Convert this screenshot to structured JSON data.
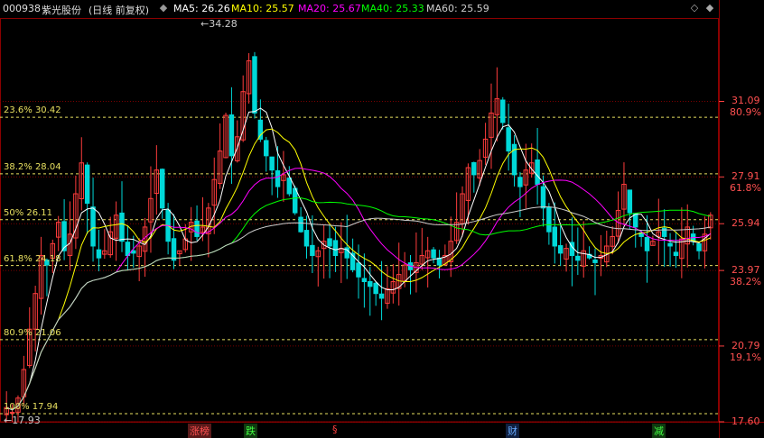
{
  "header": {
    "code": "000938",
    "name": "紫光股份",
    "mode": "(日线 前复权)",
    "ma5": {
      "label": "MA5:",
      "value": "26.26",
      "color": "#ffffff"
    },
    "ma10": {
      "label": "MA10:",
      "value": "25.57",
      "color": "#ffff00"
    },
    "ma20": {
      "label": "MA20:",
      "value": "25.67",
      "color": "#ff00ff"
    },
    "ma40": {
      "label": "MA40:",
      "value": "25.33",
      "color": "#00ff00"
    },
    "ma60": {
      "label": "MA60:",
      "value": "25.59",
      "color": "#cccccc"
    },
    "scroll_up_icon": "◇",
    "settings_icon": "◆"
  },
  "price_axis": {
    "max_marker": "34.28",
    "min_marker": "17.93",
    "ticks": [
      {
        "price": "31.09",
        "pct": "80.9%",
        "value": 31.09
      },
      {
        "price": "27.91",
        "pct": "61.8%",
        "value": 27.91
      },
      {
        "price": "25.94",
        "pct": "",
        "value": 25.94
      },
      {
        "price": "23.97",
        "pct": "38.2%",
        "value": 23.97
      },
      {
        "price": "20.79",
        "pct": "19.1%",
        "value": 20.79
      },
      {
        "price": "17.60",
        "pct": "",
        "value": 17.6
      }
    ]
  },
  "fibonacci": [
    {
      "label": "23.6% 30.42",
      "value": 30.42
    },
    {
      "label": "38.2% 28.04",
      "value": 28.04
    },
    {
      "label": "50% 26.11",
      "value": 26.11
    },
    {
      "label": "61.8% 24.18",
      "value": 24.18
    },
    {
      "label": "80.9% 21.06",
      "value": 21.06
    },
    {
      "label": "100% 17.94",
      "value": 17.94
    }
  ],
  "events": [
    {
      "label": "涨榜",
      "color": "#ff5050",
      "bg": "#5a1a1a"
    },
    {
      "label": "跌",
      "color": "#40ff40",
      "bg": "#103a10"
    },
    {
      "label": "§",
      "color": "#ff4040",
      "bg": "transparent"
    },
    {
      "label": "财",
      "color": "#66aaff",
      "bg": "#102040"
    },
    {
      "label": "减",
      "color": "#40ff40",
      "bg": "#103a10"
    }
  ],
  "chart_data": {
    "type": "candlestick",
    "ylim": [
      17.6,
      34.6
    ],
    "series": [
      {
        "name": "MA5",
        "color": "#ffffff"
      },
      {
        "name": "MA10",
        "color": "#ffff00"
      },
      {
        "name": "MA20",
        "color": "#ff00ff"
      },
      {
        "name": "MA40",
        "color": "#00ff00"
      },
      {
        "name": "MA60",
        "color": "#cccccc"
      }
    ],
    "closes": [
      18.2,
      18.0,
      18.6,
      19.8,
      21.5,
      23.0,
      24.6,
      24.2,
      25.1,
      26.0,
      24.8,
      25.5,
      27.2,
      28.5,
      26.8,
      25.0,
      24.5,
      24.8,
      25.6,
      26.3,
      25.2,
      24.6,
      24.7,
      25.0,
      25.8,
      27.0,
      28.2,
      26.6,
      25.2,
      24.4,
      24.8,
      25.3,
      26.0,
      25.4,
      25.8,
      26.6,
      27.8,
      29.0,
      30.5,
      28.8,
      29.6,
      31.5,
      32.8,
      30.6,
      29.5,
      28.8,
      28.2,
      27.5,
      28.0,
      27.2,
      26.4,
      25.6,
      25.0,
      24.6,
      24.8,
      25.2,
      25.0,
      24.6,
      24.9,
      24.5,
      24.0,
      23.7,
      23.5,
      23.3,
      23.0,
      22.8,
      23.2,
      23.5,
      23.8,
      24.2,
      24.0,
      24.3,
      24.6,
      24.8,
      24.5,
      24.2,
      24.6,
      25.2,
      26.0,
      27.2,
      28.3,
      28.0,
      28.6,
      29.5,
      30.6,
      31.2,
      30.2,
      29.0,
      28.0,
      27.5,
      28.2,
      28.5,
      27.6,
      26.6,
      25.6,
      25.0,
      24.7,
      24.9,
      24.6,
      24.4,
      24.8,
      24.5,
      24.3,
      24.6,
      25.0,
      25.4,
      26.5,
      27.6,
      26.4,
      25.8,
      25.4,
      24.8,
      25.2,
      25.6,
      25.4,
      25.0,
      24.6,
      25.3,
      25.8,
      25.2,
      24.8,
      25.5,
      26.3
    ],
    "wick_extremes": {
      "high": 34.28,
      "low": 17.93
    }
  }
}
